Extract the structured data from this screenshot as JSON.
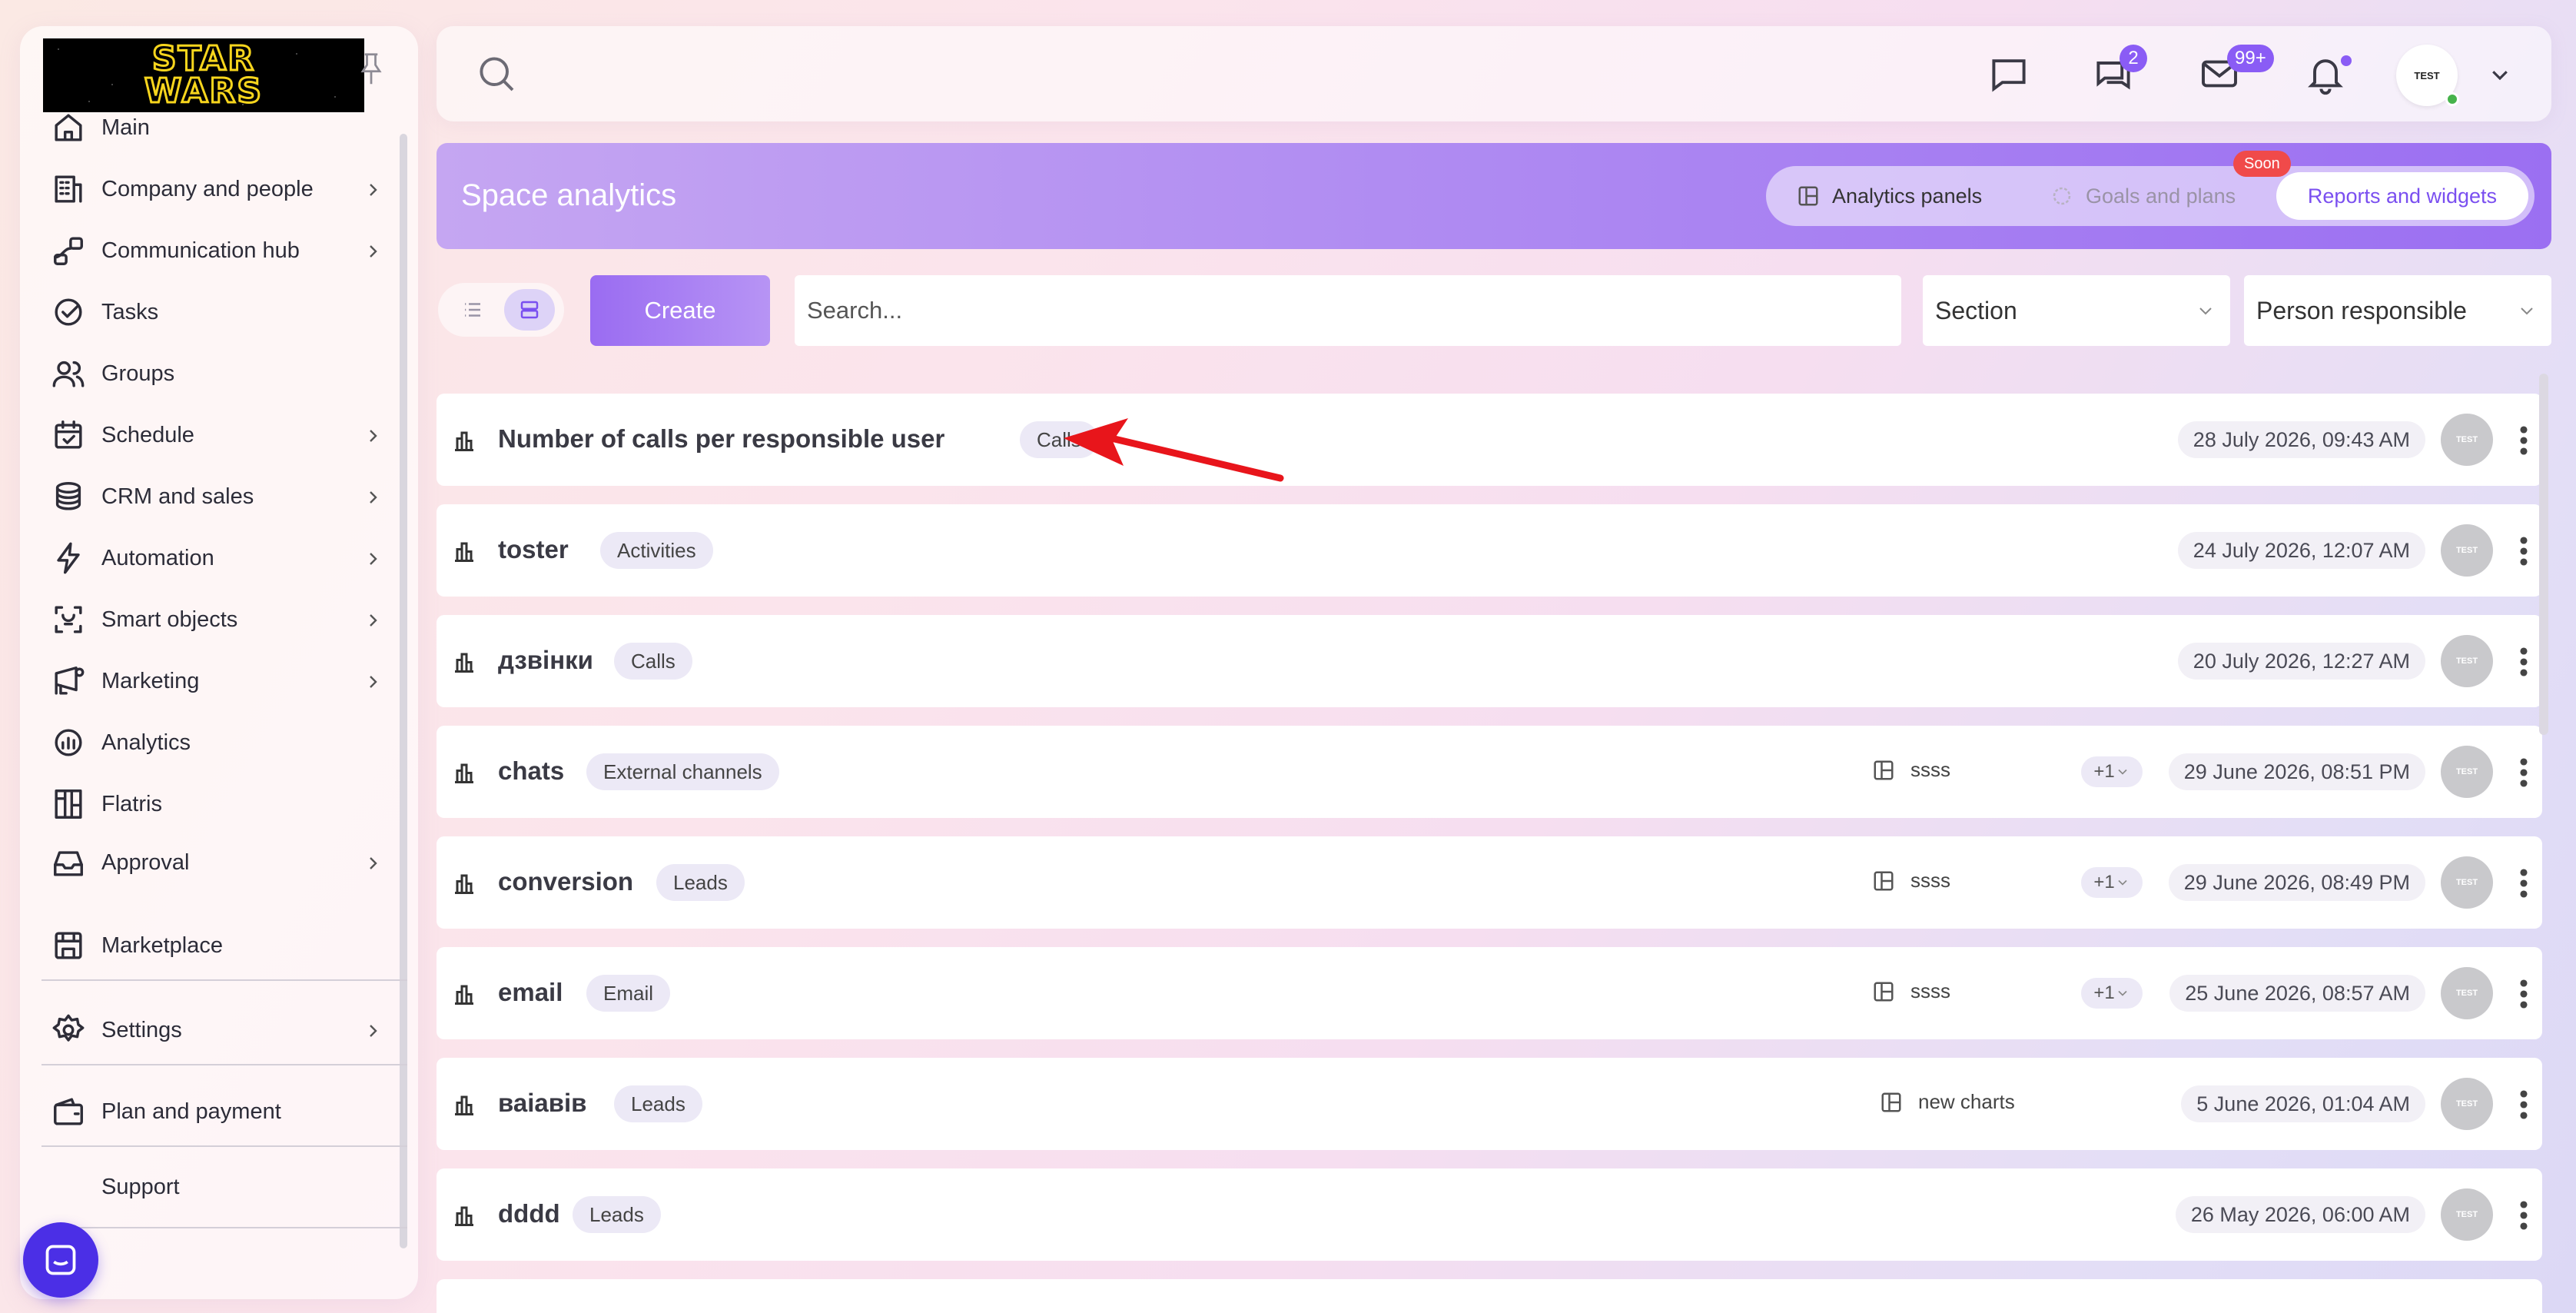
{
  "sidebar": {
    "logo_line1": "STAR",
    "logo_line2": "WARS",
    "items": [
      {
        "label": "Main",
        "icon": "home-icon",
        "has_submenu": false
      },
      {
        "label": "Company and people",
        "icon": "building-icon",
        "has_submenu": true
      },
      {
        "label": "Communication hub",
        "icon": "chat-path-icon",
        "has_submenu": true
      },
      {
        "label": "Tasks",
        "icon": "check-circle-icon",
        "has_submenu": false
      },
      {
        "label": "Groups",
        "icon": "users-icon",
        "has_submenu": false
      },
      {
        "label": "Schedule",
        "icon": "calendar-check-icon",
        "has_submenu": true
      },
      {
        "label": "CRM and sales",
        "icon": "coins-stack-icon",
        "has_submenu": true
      },
      {
        "label": "Automation",
        "icon": "lightning-icon",
        "has_submenu": true
      },
      {
        "label": "Smart objects",
        "icon": "smart-frame-icon",
        "has_submenu": true
      },
      {
        "label": "Marketing",
        "icon": "megaphone-icon",
        "has_submenu": true
      },
      {
        "label": "Analytics",
        "icon": "analytics-icon",
        "has_submenu": false
      },
      {
        "label": "Flatris",
        "icon": "flatris-icon",
        "has_submenu": false
      },
      {
        "label": "Approval",
        "icon": "inbox-tray-icon",
        "has_submenu": true
      },
      {
        "label": "Marketplace",
        "icon": "store-icon",
        "has_submenu": false
      },
      {
        "label": "Settings",
        "icon": "gear-icon",
        "has_submenu": true
      },
      {
        "label": "Plan and payment",
        "icon": "wallet-icon",
        "has_submenu": false
      },
      {
        "label": "Support",
        "icon": "support-icon",
        "has_submenu": false
      }
    ]
  },
  "topbar": {
    "chat_badge": "2",
    "mail_badge": "99+",
    "avatar_text": "TEST"
  },
  "header": {
    "title": "Space analytics",
    "tabs": [
      {
        "label": "Analytics panels",
        "state": "normal"
      },
      {
        "label": "Goals and plans",
        "state": "disabled"
      },
      {
        "label": "Reports and widgets",
        "state": "active"
      }
    ],
    "soon_badge": "Soon"
  },
  "toolbar": {
    "create_label": "Create",
    "search_placeholder": "Search...",
    "section_label": "Section",
    "person_label": "Person responsible"
  },
  "reports": [
    {
      "title": "Number of calls per responsible user",
      "tag": "Calls",
      "panel": "",
      "extra": "",
      "date": "28 July 2026, 09:43 AM"
    },
    {
      "title": "toster",
      "tag": "Activities",
      "panel": "",
      "extra": "",
      "date": "24 July 2026, 12:07 AM"
    },
    {
      "title": "дзвінки",
      "tag": "Calls",
      "panel": "",
      "extra": "",
      "date": "20 July 2026, 12:27 AM"
    },
    {
      "title": "chats",
      "tag": "External channels",
      "panel": "ssss",
      "extra": "+1",
      "date": "29 June 2026, 08:51 PM"
    },
    {
      "title": "conversion",
      "tag": "Leads",
      "panel": "ssss",
      "extra": "+1",
      "date": "29 June 2026, 08:49 PM"
    },
    {
      "title": "email",
      "tag": "Email",
      "panel": "ssss",
      "extra": "+1",
      "date": "25 June 2026, 08:57 AM"
    },
    {
      "title": "ваіавів",
      "tag": "Leads",
      "panel": "new charts",
      "extra": "",
      "date": "5 June 2026, 01:04 AM"
    },
    {
      "title": "dddd",
      "tag": "Leads",
      "panel": "",
      "extra": "",
      "date": "26 May 2026, 06:00 AM"
    }
  ],
  "row_avatar_text": "TEST",
  "colors": {
    "accent": "#8a5cf5",
    "banner_start": "#c5a6f2",
    "banner_end": "#9b6ff2",
    "soon": "#f04a4a",
    "annotation_arrow": "#e8151b"
  }
}
